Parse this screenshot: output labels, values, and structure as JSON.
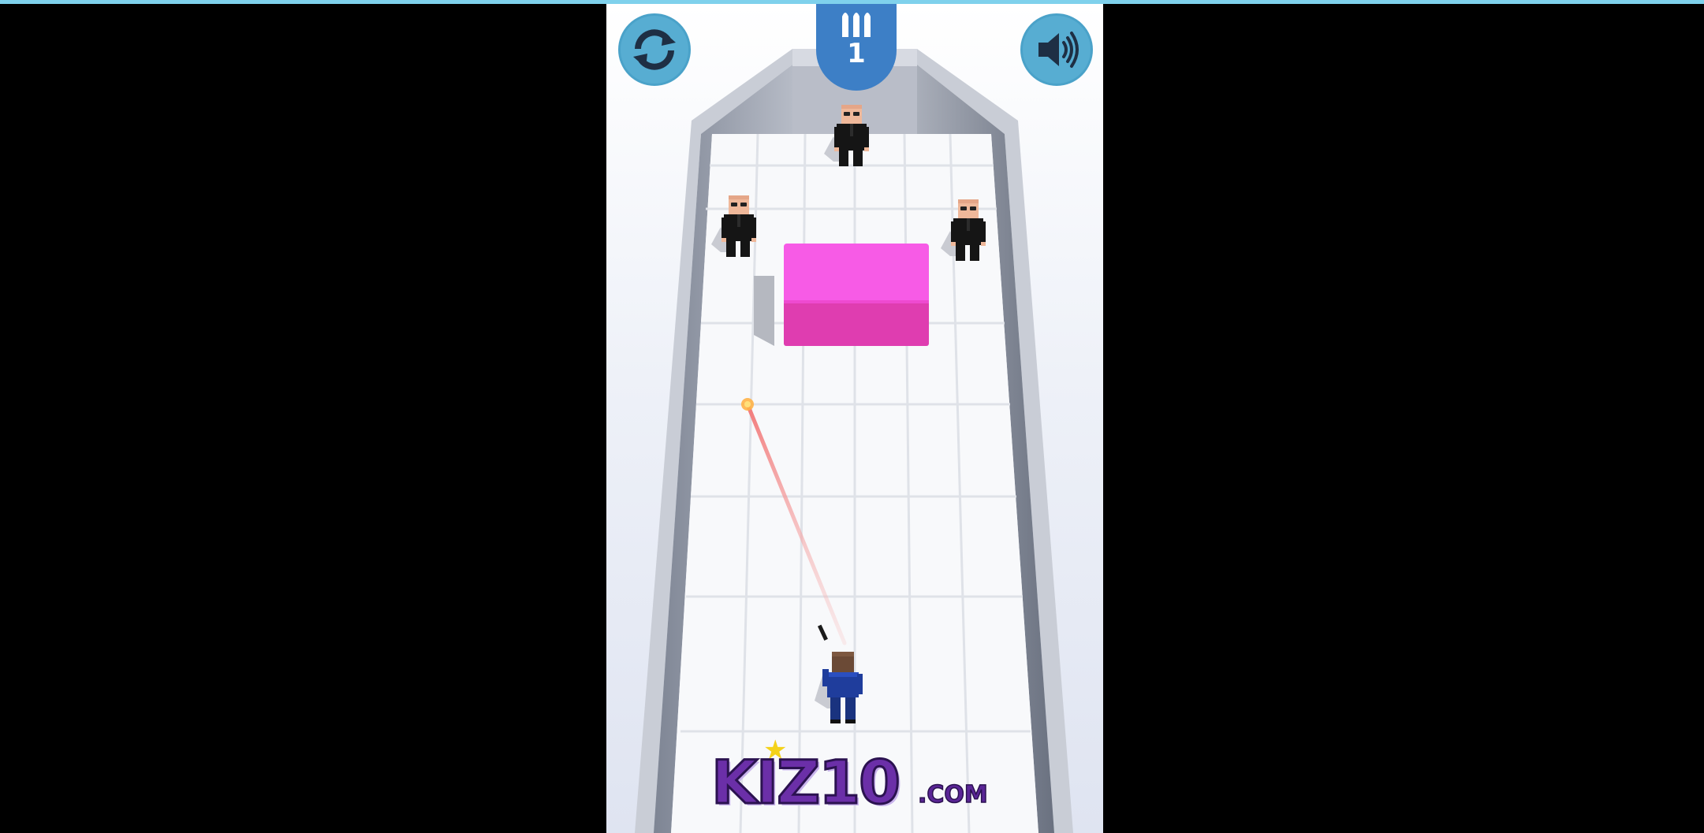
{
  "game": {
    "ammo_count": "1",
    "ammo_icon": "bullets-icon",
    "restart_icon": "restart-arrows-icon",
    "sound_icon": "speaker-icon",
    "enemies": [
      {
        "name": "enemy-agent-top"
      },
      {
        "name": "enemy-agent-left"
      },
      {
        "name": "enemy-agent-right"
      }
    ],
    "obstacle_color": "#ef4fd6",
    "laser_color": "#f27a7a",
    "player_suit_color": "#1f3d9c"
  },
  "branding": {
    "logo_main": "KIZ10",
    "logo_suffix": ".COM"
  },
  "colors": {
    "hud_blue": "#57add2",
    "badge_blue": "#3d7fc6",
    "top_strip": "#7fd1ec"
  }
}
